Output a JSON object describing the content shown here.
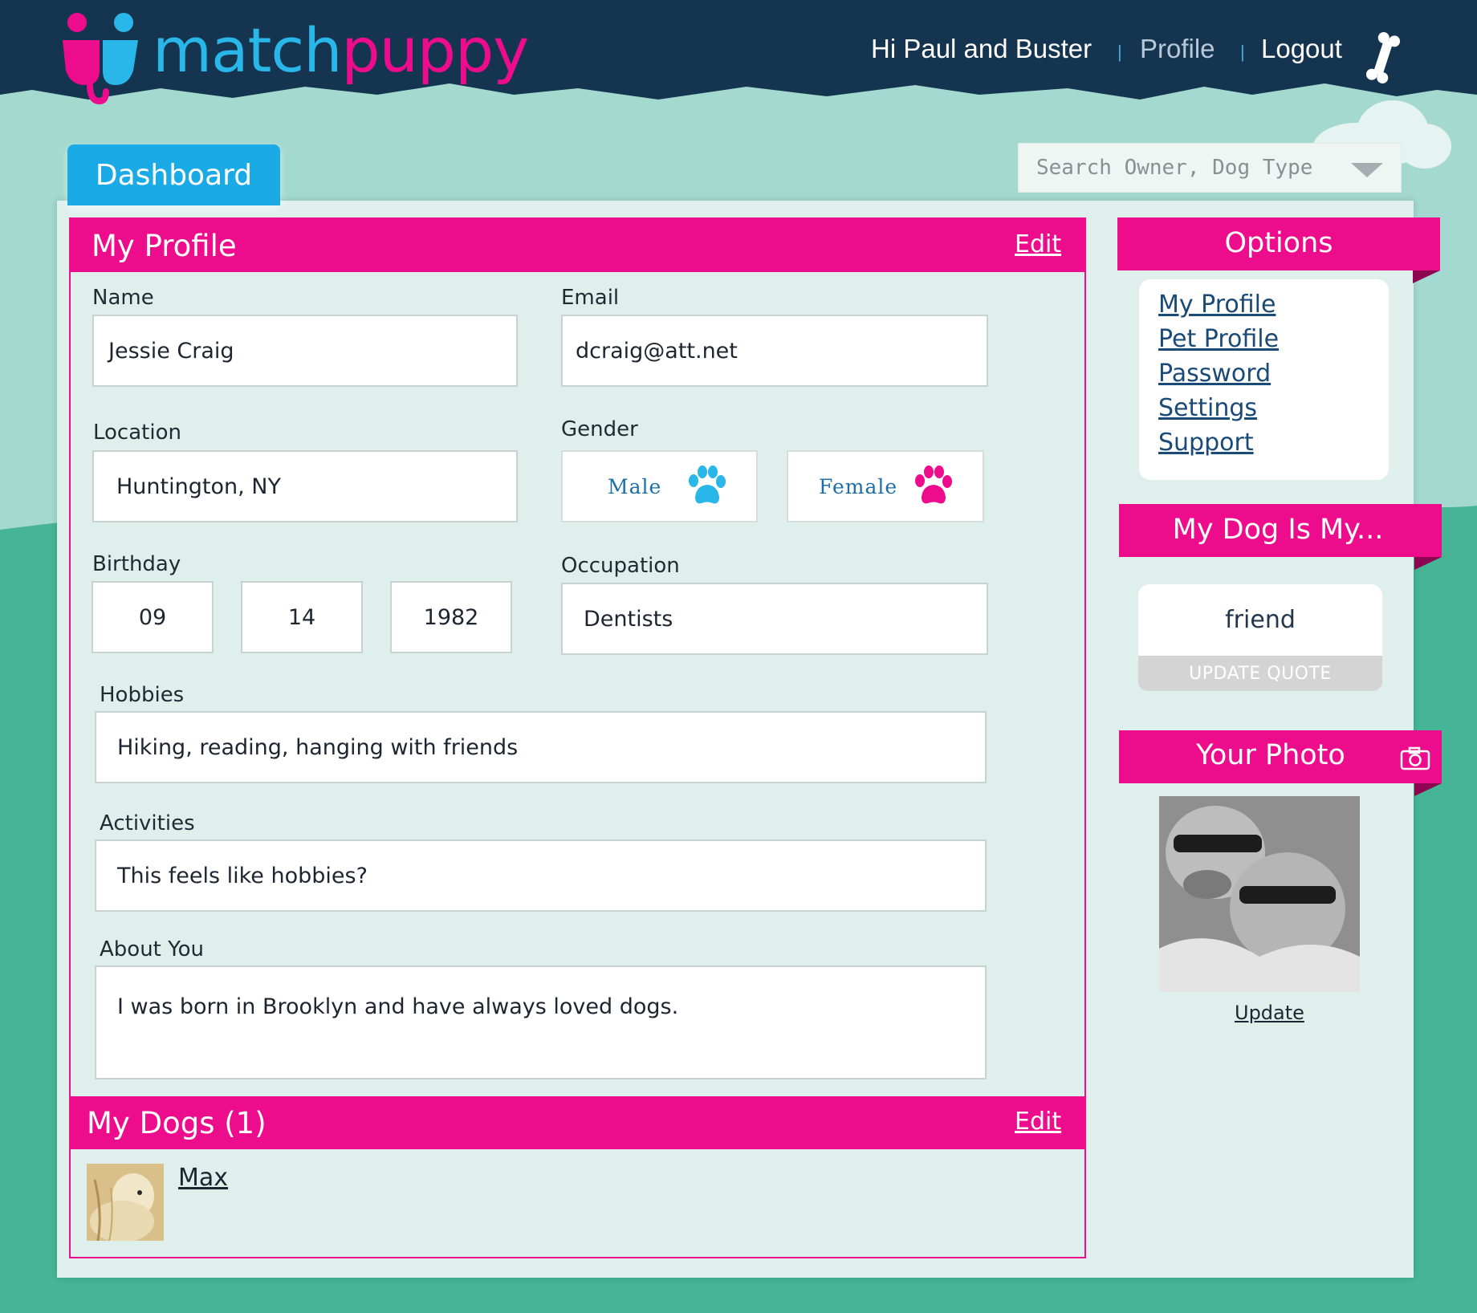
{
  "brand": {
    "part1": "match",
    "part2": "puppy"
  },
  "header": {
    "greeting": "Hi Paul and Buster",
    "separator": "|",
    "profile_link": "Profile",
    "logout_link": "Logout"
  },
  "dashboard_tab": "Dashboard",
  "search": {
    "placeholder": "Search Owner, Dog Type"
  },
  "my_profile": {
    "title": "My Profile",
    "edit": "Edit",
    "name": {
      "label": "Name",
      "value": "Jessie Craig"
    },
    "email": {
      "label": "Email",
      "value": "dcraig@att.net"
    },
    "location": {
      "label": "Location",
      "value": "Huntington, NY"
    },
    "gender": {
      "label": "Gender",
      "options": [
        "Male",
        "Female"
      ]
    },
    "birthday": {
      "label": "Birthday",
      "month": "09",
      "day": "14",
      "year": "1982"
    },
    "occupation": {
      "label": "Occupation",
      "value": "Dentists"
    },
    "hobbies": {
      "label": "Hobbies",
      "value": "Hiking, reading, hanging with friends"
    },
    "activities": {
      "label": "Activities",
      "value": "This feels like hobbies?"
    },
    "about": {
      "label": "About You",
      "value": "I was born in Brooklyn and have always loved dogs."
    }
  },
  "my_dogs": {
    "title": "My Dogs (1)",
    "edit": "Edit",
    "dogs": [
      {
        "name": "Max"
      }
    ]
  },
  "options": {
    "title": "Options",
    "links": [
      "My Profile",
      "Pet Profile",
      "Password",
      "Settings",
      "Support"
    ]
  },
  "my_dog_is": {
    "title": "My Dog Is My...",
    "quote": "friend",
    "button": "UPDATE QUOTE"
  },
  "your_photo": {
    "title": "Your Photo",
    "update": "Update"
  },
  "colors": {
    "navy": "#15344f",
    "pink": "#ec0c8c",
    "blue": "#1aaae6",
    "mint": "#a3d9cf",
    "green": "#45b596"
  },
  "icons": [
    "logo-icon",
    "bone-icon",
    "paw-icon",
    "camera-icon",
    "dropdown-caret-icon"
  ]
}
